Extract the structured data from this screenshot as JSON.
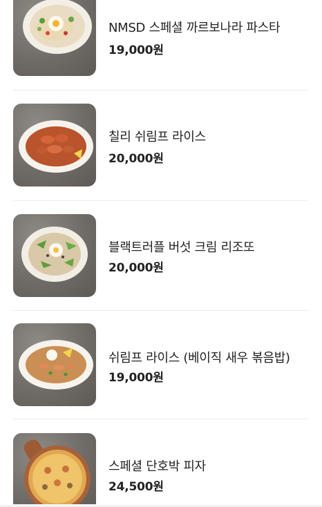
{
  "menu": {
    "items": [
      {
        "name": "NMSD 스페셜 까르보나라 파스타",
        "price": "19,000원",
        "image": "carbonara-pasta-photo"
      },
      {
        "name": "칠리 쉬림프 라이스",
        "price": "20,000원",
        "image": "chili-shrimp-rice-photo"
      },
      {
        "name": "블랙트러플 버섯 크림 리조또",
        "price": "20,000원",
        "image": "truffle-risotto-photo"
      },
      {
        "name": "쉬림프 라이스 (베이직 새우 볶음밥)",
        "price": "19,000원",
        "image": "shrimp-fried-rice-photo"
      },
      {
        "name": "스페셜 단호박 피자",
        "price": "24,500원",
        "image": "pumpkin-pizza-photo"
      }
    ]
  }
}
